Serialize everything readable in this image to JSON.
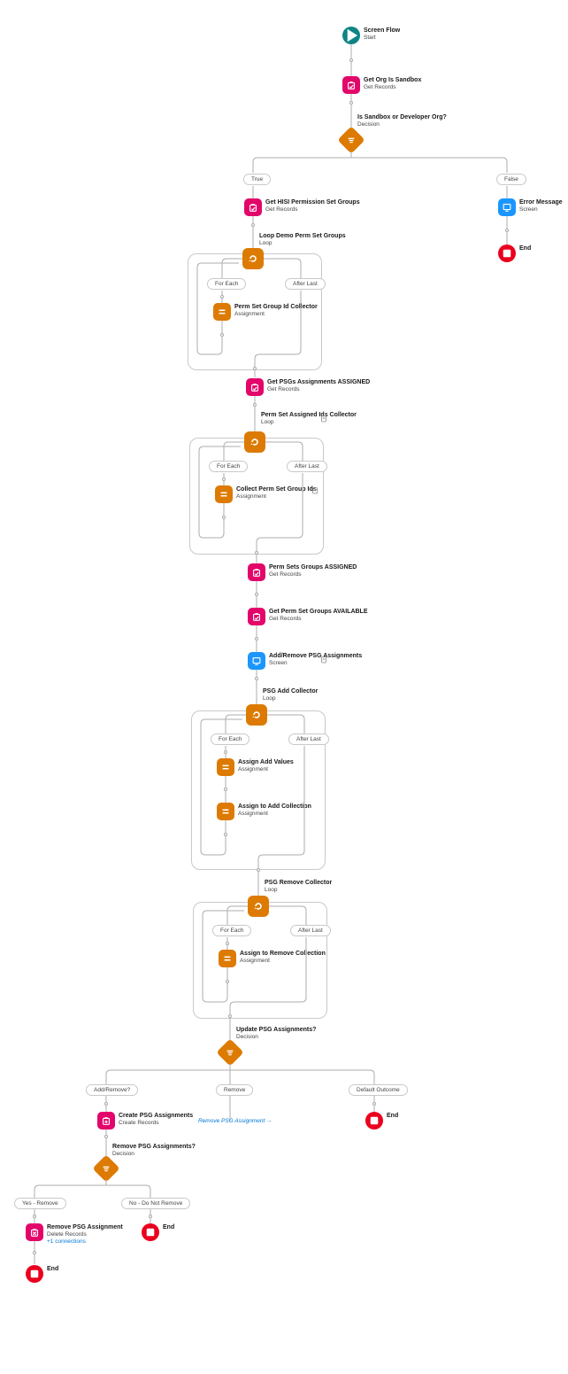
{
  "colors": {
    "teal": "#108484",
    "pink": "#e3066a",
    "blue": "#1b96ff",
    "orange": "#dd7a01",
    "red": "#ea001e"
  },
  "start": {
    "title": "Screen Flow",
    "sub": "Start"
  },
  "n1": {
    "title": "Get Org Is Sandbox",
    "sub": "Get Records"
  },
  "d1": {
    "title": "Is Sandbox or Developer Org?",
    "sub": "Decision"
  },
  "pill_true": "True",
  "pill_false": "False",
  "n2": {
    "title": "Get HISI Permission Set Groups",
    "sub": "Get Records"
  },
  "err": {
    "title": "Error Message",
    "sub": "Screen"
  },
  "end_err": "End",
  "n3": {
    "title": "Loop Demo Perm Set Groups",
    "sub": "Loop"
  },
  "pill_foreach": "For Each",
  "pill_afterlast": "After Last",
  "n4": {
    "title": "Perm Set Group Id Collector",
    "sub": "Assignment"
  },
  "n5": {
    "title": "Get PSGs Assignments ASSIGNED",
    "sub": "Get Records"
  },
  "n6": {
    "title": "Perm Set Assigned Ids Collector",
    "sub": "Loop"
  },
  "n7": {
    "title": "Collect Perm Set Group Ids",
    "sub": "Assignment"
  },
  "n8": {
    "title": "Perm Sets Groups ASSIGNED",
    "sub": "Get Records"
  },
  "n9": {
    "title": "Get Perm Set Groups AVAILABLE",
    "sub": "Get Records"
  },
  "n10": {
    "title": "Add/Remove PSG Assignments",
    "sub": "Screen"
  },
  "n11": {
    "title": "PSG Add Collector",
    "sub": "Loop"
  },
  "n12": {
    "title": "Assign Add Values",
    "sub": "Assignment"
  },
  "n13": {
    "title": "Assign to Add Collection",
    "sub": "Assignment"
  },
  "n14": {
    "title": "PSG Remove Collector",
    "sub": "Loop"
  },
  "n15": {
    "title": "Assign to Remove Collection",
    "sub": "Assignment"
  },
  "d2": {
    "title": "Update PSG Assignments?",
    "sub": "Decision"
  },
  "pill_addremove": "Add/Remove?",
  "pill_remove": "Remove",
  "pill_default": "Default Outcome",
  "goto_remove": "Remove PSG Assignment →",
  "end_default": "End",
  "n16": {
    "title": "Create PSG Assignments",
    "sub": "Create Records"
  },
  "d3": {
    "title": "Remove PSG Assignments?",
    "sub": "Decision"
  },
  "pill_yes": "Yes - Remove",
  "pill_no": "No - Do Not Remove",
  "end_no": "End",
  "n17": {
    "title": "Remove PSG Assignment",
    "sub": "Delete Records",
    "extra": "+1 connections"
  },
  "end_yes": "End"
}
